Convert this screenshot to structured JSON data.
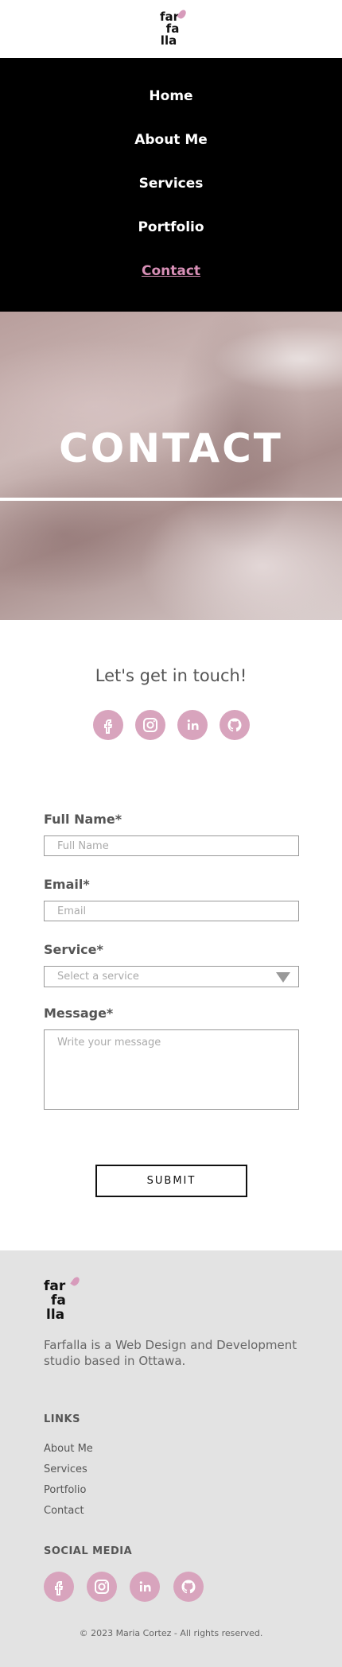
{
  "header": {
    "logo": {
      "line1": "far",
      "line2": "fa",
      "line3": "lla"
    }
  },
  "nav": {
    "items": [
      {
        "label": "Home"
      },
      {
        "label": "About Me"
      },
      {
        "label": "Services"
      },
      {
        "label": "Portfolio"
      },
      {
        "label": "Contact",
        "active": true
      }
    ]
  },
  "hero": {
    "title": "CONTACT"
  },
  "contact": {
    "subtitle": "Let's get in touch!",
    "social_icons": [
      "facebook-icon",
      "instagram-icon",
      "linkedin-icon",
      "github-icon"
    ]
  },
  "form": {
    "full_name": {
      "label": "Full Name*",
      "placeholder": "Full Name",
      "value": ""
    },
    "email": {
      "label": "Email*",
      "placeholder": "Email",
      "value": ""
    },
    "service": {
      "label": "Service*",
      "selected": "Select a service"
    },
    "message": {
      "label": "Message*",
      "placeholder": "Write your message",
      "value": ""
    },
    "submit_label": "SUBMIT"
  },
  "footer": {
    "logo": {
      "line1": "far",
      "line2": "fa",
      "line3": "lla"
    },
    "description": "Farfalla is a Web Design and Development studio based in Ottawa.",
    "links_heading": "LINKS",
    "links": [
      "About Me",
      "Services",
      "Portfolio",
      "Contact"
    ],
    "social_heading": "SOCIAL MEDIA",
    "copyright": "© 2023 Maria Cortez - All rights reserved."
  },
  "colors": {
    "accent": "#d8a4bd",
    "nav_background": "#000000",
    "footer_background": "#e3e3e3",
    "active_link": "#d78fb6"
  }
}
